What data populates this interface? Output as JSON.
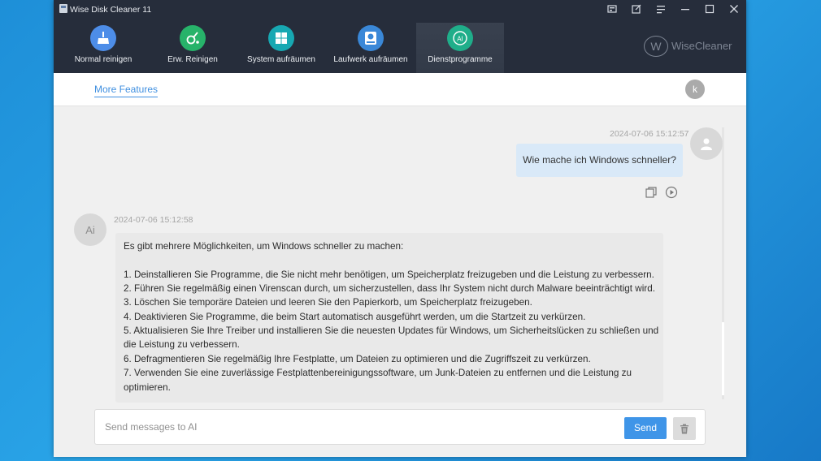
{
  "window": {
    "title": "Wise Disk Cleaner 11"
  },
  "titlebar_buttons": [
    {
      "icon": "skin-icon"
    },
    {
      "icon": "feedback-icon"
    },
    {
      "icon": "menu-icon"
    },
    {
      "icon": "minimize-icon"
    },
    {
      "icon": "maximize-icon"
    },
    {
      "icon": "close-icon"
    }
  ],
  "nav": {
    "items": [
      {
        "label": "Normal reinigen",
        "icon": "broom-icon",
        "color": "#4d8de8"
      },
      {
        "label": "Erw. Reinigen",
        "icon": "deep-clean-icon",
        "color": "#27b36a"
      },
      {
        "label": "System aufräumen",
        "icon": "windows-icon",
        "color": "#17a8b2"
      },
      {
        "label": "Laufwerk aufräumen",
        "icon": "drive-icon",
        "color": "#3a88d8"
      },
      {
        "label": "Dienstprogramme",
        "icon": "ai-icon",
        "color": "#1fae8a",
        "active": true
      }
    ]
  },
  "brand": {
    "logo": "W",
    "name": "WiseCleaner"
  },
  "subbar": {
    "more_features": "More Features",
    "user_initial": "k"
  },
  "chat": {
    "user_message": {
      "timestamp": "2024-07-06 15:12:57",
      "text": "Wie mache ich Windows schneller?"
    },
    "ai_message": {
      "avatar": "Ai",
      "timestamp": "2024-07-06 15:12:58",
      "lines": [
        "Es gibt mehrere Möglichkeiten, um Windows schneller zu machen:",
        "1. Deinstallieren Sie Programme, die Sie nicht mehr benötigen, um Speicherplatz freizugeben und die Leistung zu verbessern.",
        "2. Führen Sie regelmäßig einen Virenscan durch, um sicherzustellen, dass Ihr System nicht durch Malware beeinträchtigt wird.",
        "3. Löschen Sie temporäre Dateien und leeren Sie den Papierkorb, um Speicherplatz freizugeben.",
        "4. Deaktivieren Sie Programme, die beim Start automatisch ausgeführt werden, um die Startzeit zu verkürzen.",
        "5. Aktualisieren Sie Ihre Treiber und installieren Sie die neuesten Updates für Windows, um Sicherheitslücken zu schließen und",
        "die Leistung zu verbessern.",
        "6. Defragmentieren Sie regelmäßig Ihre Festplatte, um Dateien zu optimieren und die Zugriffszeit zu verkürzen.",
        "7. Verwenden Sie eine zuverlässige Festplattenbereinigungssoftware, um Junk-Dateien zu entfernen und die Leistung zu",
        "optimieren."
      ]
    }
  },
  "input": {
    "placeholder": "Send messages to AI",
    "value": "",
    "send_label": "Send"
  }
}
